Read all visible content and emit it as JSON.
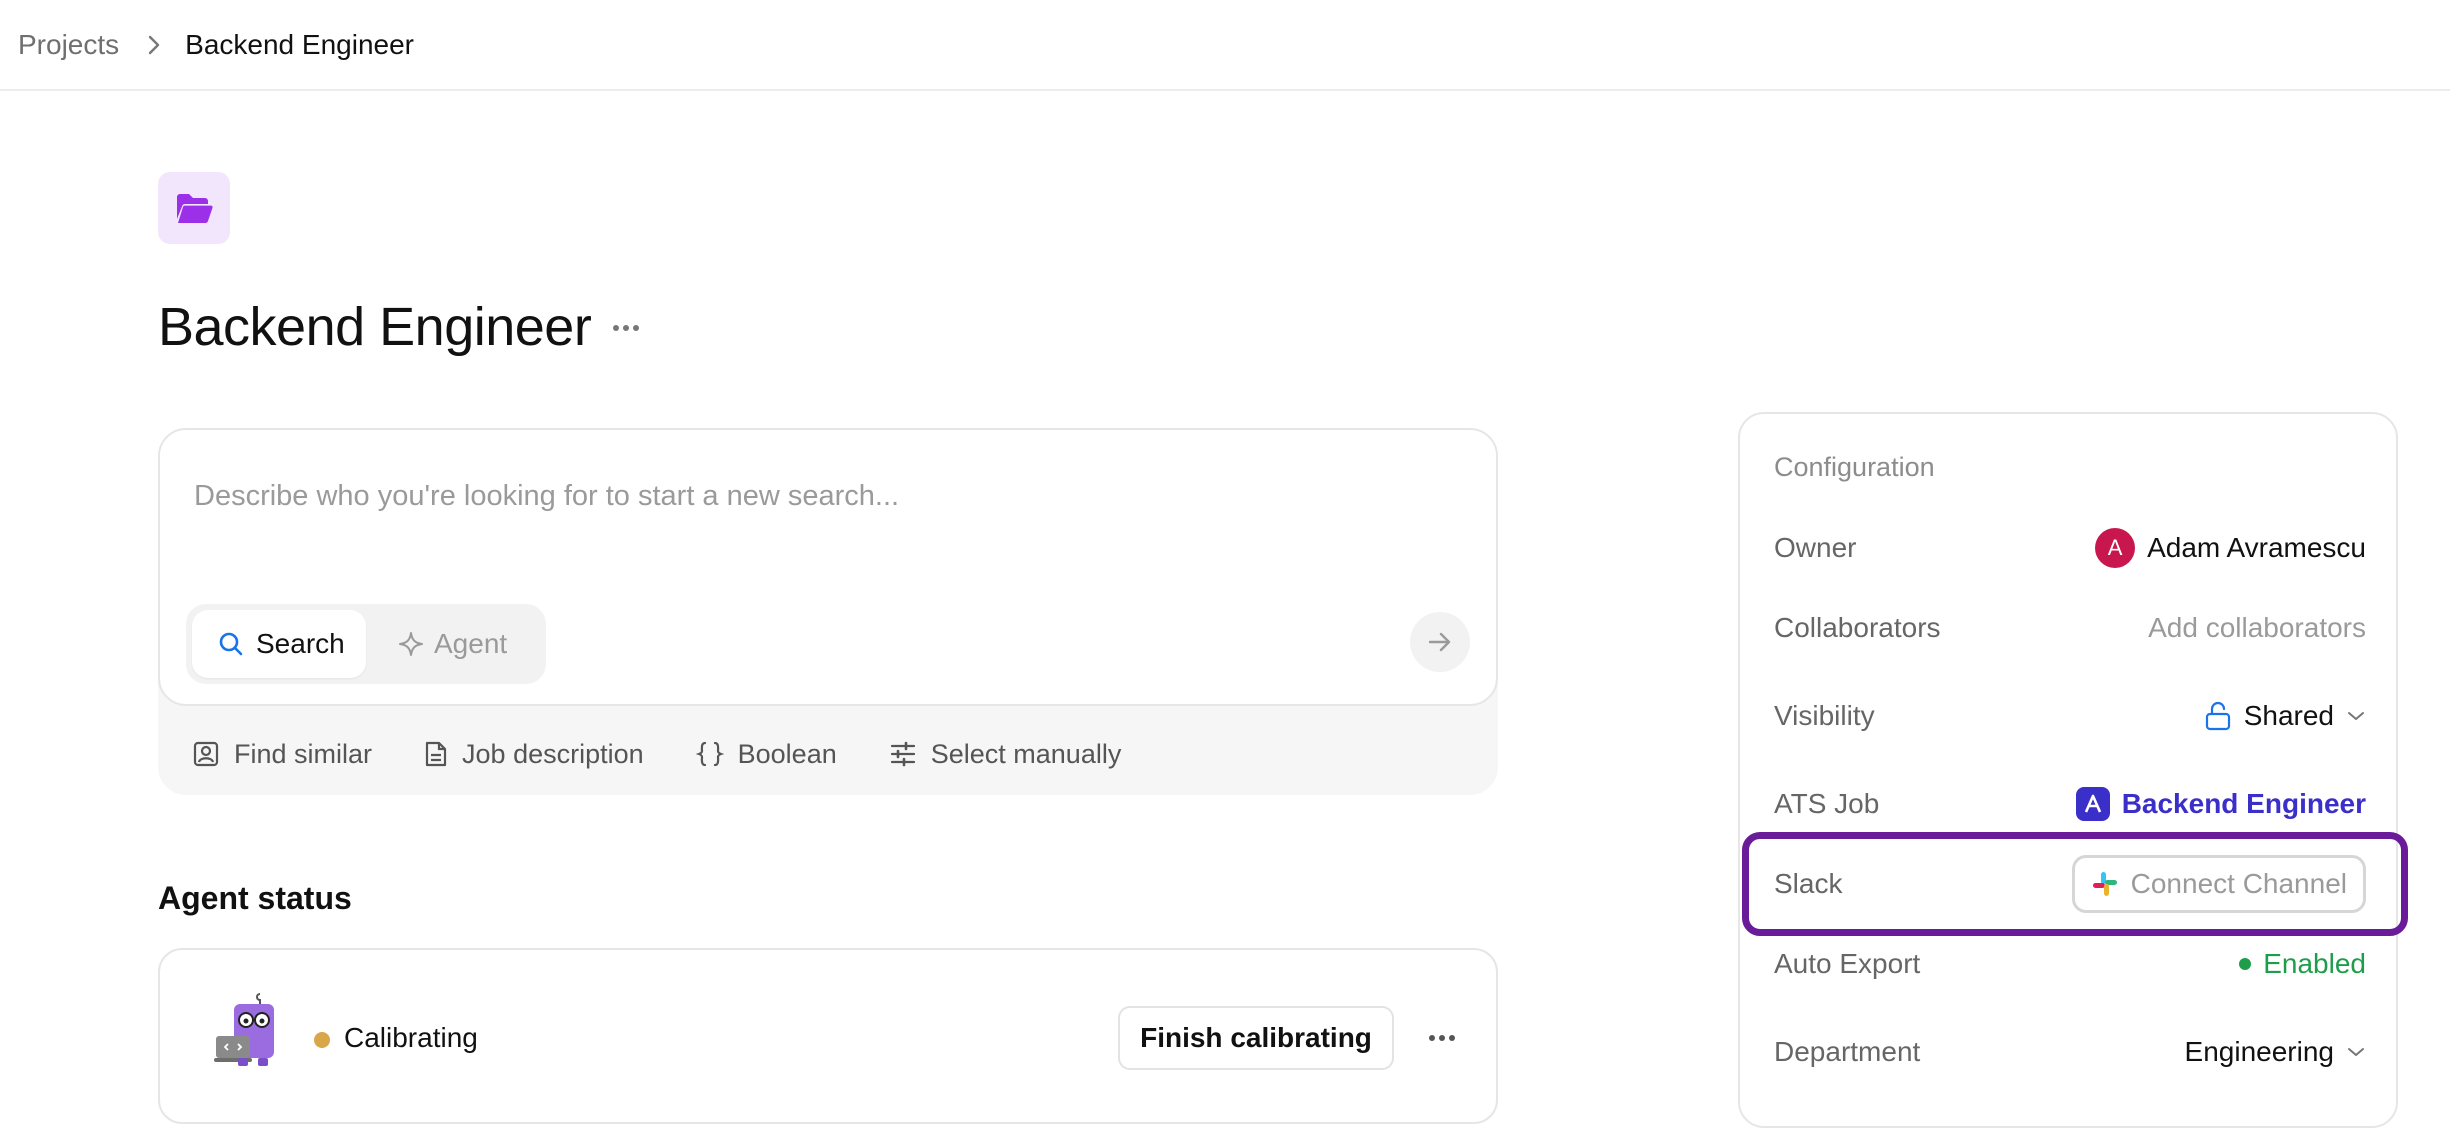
{
  "breadcrumb": {
    "parent": "Projects",
    "current": "Backend Engineer"
  },
  "project": {
    "title": "Backend Engineer",
    "icon": "folder-open-icon",
    "accent_color": "#9b30e8"
  },
  "composer": {
    "placeholder": "Describe who you're looking for to start a new search...",
    "modes": {
      "search": "Search",
      "agent": "Agent"
    },
    "quick_actions": {
      "find_similar": "Find similar",
      "job_description": "Job description",
      "boolean": "Boolean",
      "select_manually": "Select manually"
    }
  },
  "agent_status": {
    "heading": "Agent status",
    "status": "Calibrating",
    "status_color": "#d9a74a",
    "action_label": "Finish calibrating"
  },
  "configuration": {
    "title": "Configuration",
    "owner": {
      "label": "Owner",
      "initial": "A",
      "name": "Adam Avramescu",
      "avatar_color": "#c8174e"
    },
    "collaborators": {
      "label": "Collaborators",
      "value": "Add collaborators"
    },
    "visibility": {
      "label": "Visibility",
      "value": "Shared"
    },
    "ats_job": {
      "label": "ATS Job",
      "value": "Backend Engineer",
      "color": "#3b2fc9"
    },
    "slack": {
      "label": "Slack",
      "value": "Connect Channel",
      "highlight_color": "#6a1b9a"
    },
    "auto_export": {
      "label": "Auto Export",
      "value": "Enabled",
      "color": "#1e9e4a"
    },
    "department": {
      "label": "Department",
      "value": "Engineering"
    }
  }
}
